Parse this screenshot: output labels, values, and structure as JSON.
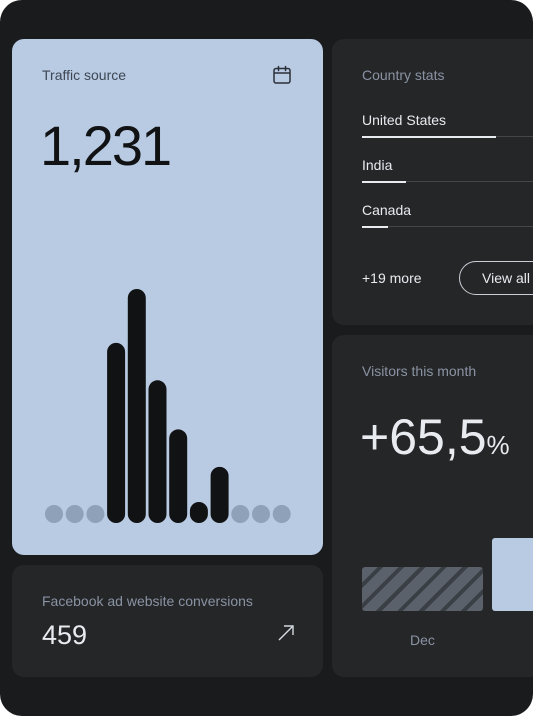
{
  "traffic": {
    "title": "Traffic source",
    "value": "1,231",
    "bar_levels": [
      0,
      0,
      0,
      0.77,
      1.0,
      0.61,
      0.4,
      0.09,
      0.24,
      0,
      0,
      0
    ],
    "colors": {
      "card": "#b9cbe3",
      "bar": "#111214",
      "dot": "#8fa0b9"
    }
  },
  "facebook": {
    "title": "Facebook ad website conversions",
    "value": "459"
  },
  "country": {
    "title": "Country stats",
    "rows": [
      {
        "name": "United States",
        "share": 0.67
      },
      {
        "name": "India",
        "share": 0.22
      },
      {
        "name": "Canada",
        "share": 0.13
      }
    ],
    "more": "+19 more",
    "view_all": "View all"
  },
  "visitors": {
    "title": "Visitors this month",
    "value": "+65,5",
    "unit": "%",
    "month": "Dec"
  },
  "icons": [
    "calendar-icon",
    "arrow-up-right-icon"
  ]
}
